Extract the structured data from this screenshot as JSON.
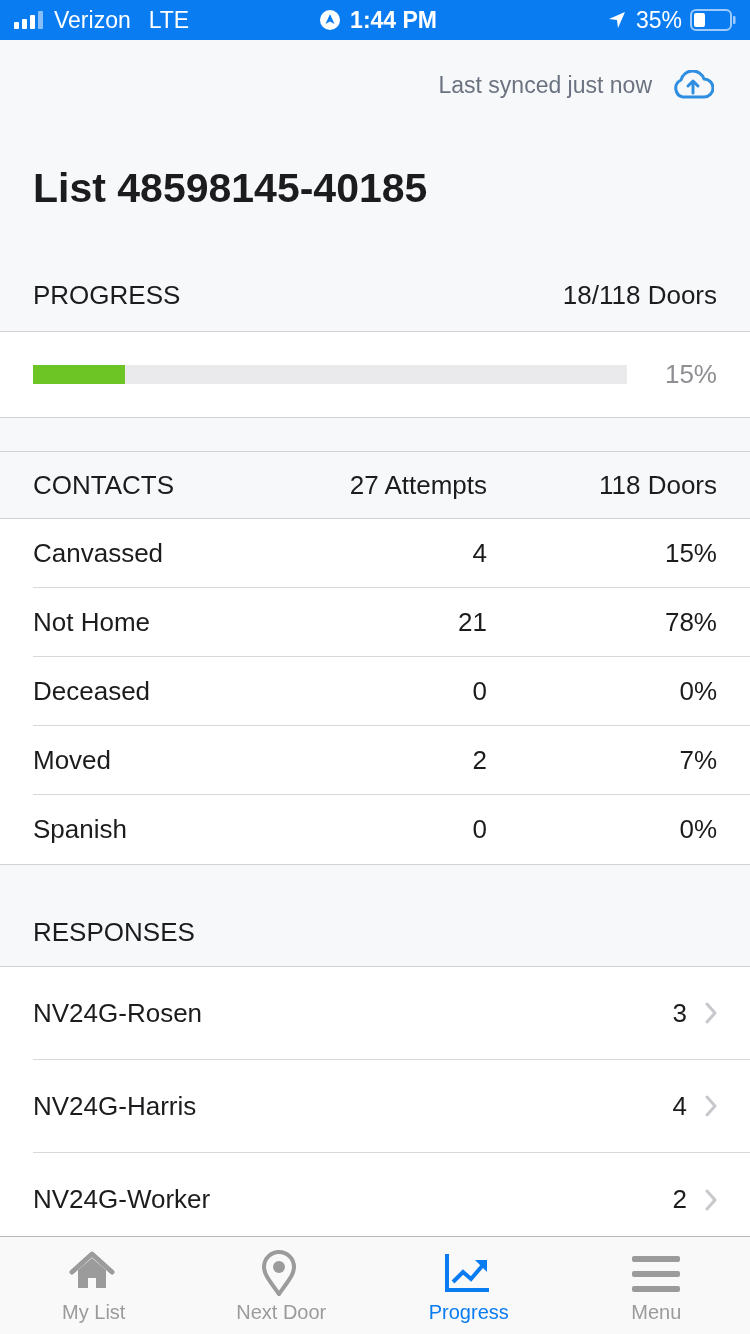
{
  "status_bar": {
    "carrier": "Verizon",
    "network": "LTE",
    "time": "1:44 PM",
    "battery": "35%"
  },
  "sync": {
    "text": "Last synced just now"
  },
  "title": "List 48598145-40185",
  "progress": {
    "label": "PROGRESS",
    "doors": "18/118 Doors",
    "level": 0.155,
    "percent": "15%"
  },
  "contacts": {
    "label": "CONTACTS",
    "attempts": "27 Attempts",
    "doors": "118 Doors",
    "rows": [
      {
        "name": "Canvassed",
        "count": "4",
        "percent": "15%"
      },
      {
        "name": "Not Home",
        "count": "21",
        "percent": "78%"
      },
      {
        "name": "Deceased",
        "count": "0",
        "percent": "0%"
      },
      {
        "name": "Moved",
        "count": "2",
        "percent": "7%"
      },
      {
        "name": "Spanish",
        "count": "0",
        "percent": "0%"
      }
    ]
  },
  "responses": {
    "label": "RESPONSES",
    "rows": [
      {
        "name": "NV24G-Rosen",
        "count": "3"
      },
      {
        "name": "NV24G-Harris",
        "count": "4"
      },
      {
        "name": "NV24G-Worker",
        "count": "2"
      }
    ]
  },
  "tabs": [
    {
      "label": "My List",
      "selected": false
    },
    {
      "label": "Next Door",
      "selected": false
    },
    {
      "label": "Progress",
      "selected": true
    },
    {
      "label": "Menu",
      "selected": false
    }
  ]
}
